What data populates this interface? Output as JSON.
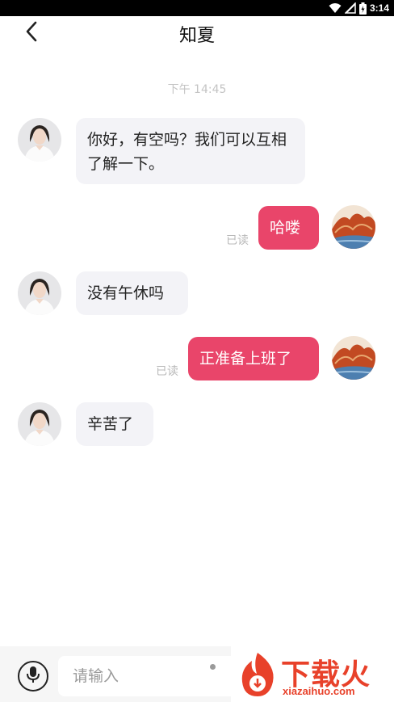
{
  "status_bar": {
    "time": "3:14"
  },
  "header": {
    "title": "知夏"
  },
  "chat": {
    "timestamp": "下午 14:45",
    "messages": [
      {
        "from": "them",
        "text": "你好，有空吗？我们可以互相了解一下。"
      },
      {
        "from": "me",
        "text": "哈喽",
        "status": "已读"
      },
      {
        "from": "them",
        "text": "没有午休吗"
      },
      {
        "from": "me",
        "text": "正准备上班了",
        "status": "已读"
      },
      {
        "from": "them",
        "text": "辛苦了"
      }
    ]
  },
  "composer": {
    "placeholder": "请输入"
  },
  "watermark": {
    "text": "下载火",
    "sub": "xiazaihuo.com"
  },
  "colors": {
    "outgoing_bubble": "#e9456a",
    "incoming_bubble": "#f3f3f7",
    "watermark": "#e8412a"
  },
  "icons": [
    "wifi-icon",
    "signal-icon",
    "battery-icon",
    "back-chevron-icon",
    "microphone-icon"
  ]
}
